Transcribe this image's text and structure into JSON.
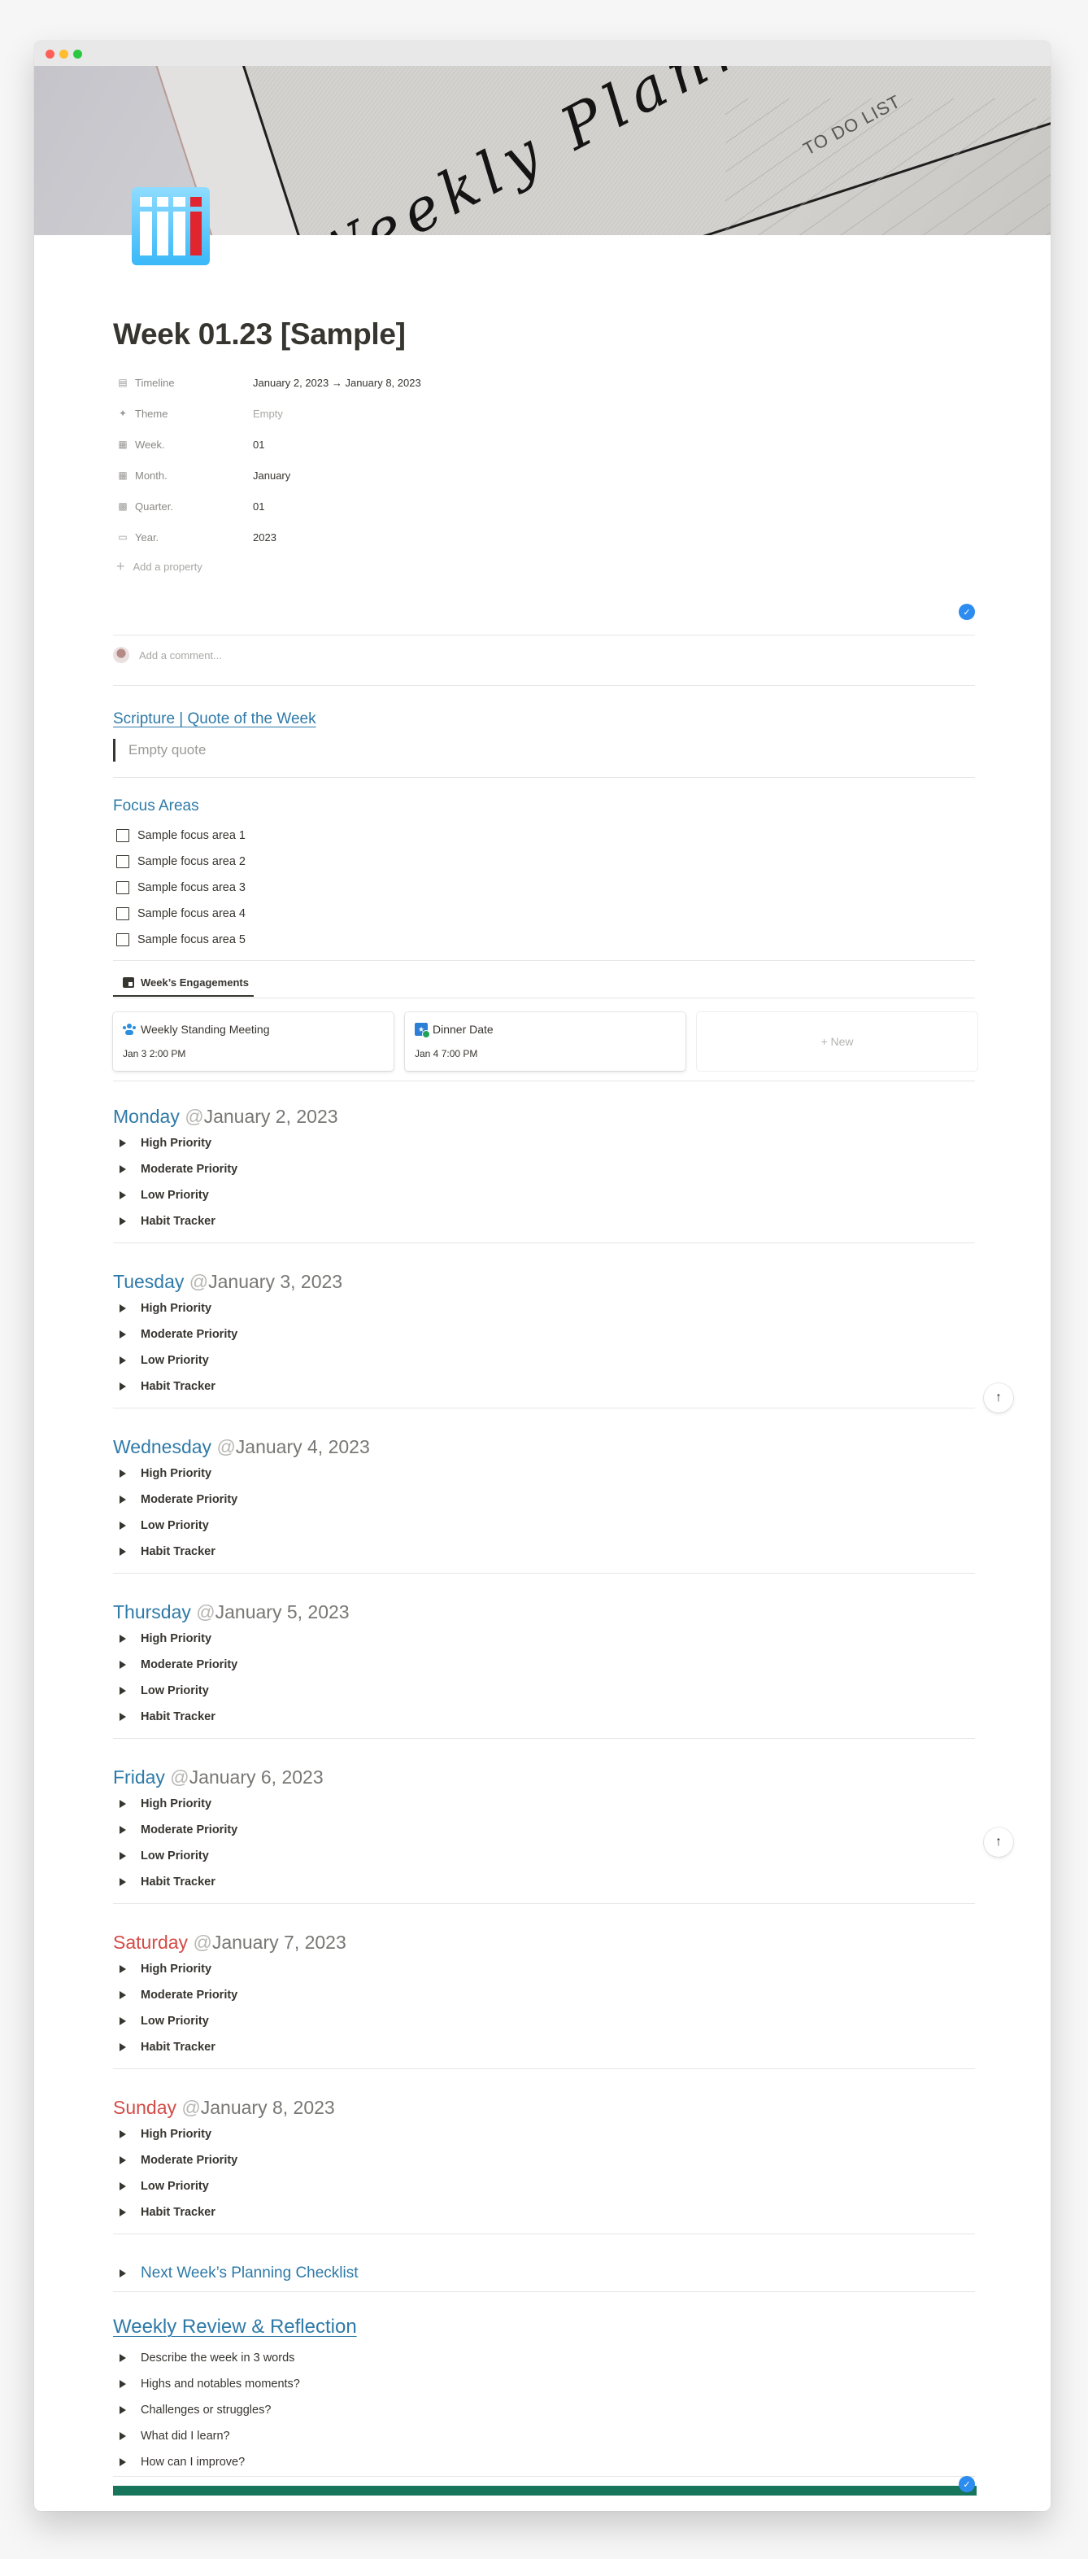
{
  "window": {
    "controls": [
      "close",
      "minimize",
      "maximize"
    ]
  },
  "cover": {
    "script_text": "Weekly Planner",
    "todo_text": "TO DO LIST"
  },
  "page": {
    "icon": "planner-bars-icon",
    "title": "Week 01.23 [Sample]"
  },
  "properties": [
    {
      "icon": "calendar-icon",
      "name": "Timeline",
      "value": "January 2, 2023 → January 8, 2023",
      "empty": false
    },
    {
      "icon": "sparkles-icon",
      "name": "Theme",
      "value": "Empty",
      "empty": true
    },
    {
      "icon": "calendar-week-icon",
      "name": "Week.",
      "value": "01",
      "empty": false
    },
    {
      "icon": "calendar-month-icon",
      "name": "Month.",
      "value": "January",
      "empty": false
    },
    {
      "icon": "grid-icon",
      "name": "Quarter.",
      "value": "01",
      "empty": false
    },
    {
      "icon": "calendar-year-icon",
      "name": "Year.",
      "value": "2023",
      "empty": false
    }
  ],
  "add_property_label": "Add a property",
  "comment": {
    "placeholder": "Add a comment..."
  },
  "quote_section": {
    "heading": "Scripture | Quote of the Week",
    "placeholder": "Empty quote"
  },
  "focus": {
    "heading": "Focus Areas",
    "items": [
      {
        "label": "Sample focus area 1",
        "checked": false
      },
      {
        "label": "Sample focus area 2",
        "checked": false
      },
      {
        "label": "Sample focus area 3",
        "checked": false
      },
      {
        "label": "Sample focus area 4",
        "checked": false
      },
      {
        "label": "Sample focus area 5",
        "checked": false
      }
    ]
  },
  "engagements": {
    "tab_label": "Week’s Engagements",
    "cards": [
      {
        "icon": "meeting-icon",
        "title": "Weekly Standing Meeting",
        "date": "Jan 3 2:00 PM"
      },
      {
        "icon": "calendar-check-icon",
        "title": "Dinner Date",
        "date": "Jan 4 7:00 PM"
      }
    ],
    "new_label": "+ New"
  },
  "days": [
    {
      "name": "Monday",
      "at": "@",
      "date": "January 2, 2023",
      "weekend": false
    },
    {
      "name": "Tuesday",
      "at": "@",
      "date": "January 3, 2023",
      "weekend": false
    },
    {
      "name": "Wednesday",
      "at": "@",
      "date": "January 4, 2023",
      "weekend": false
    },
    {
      "name": "Thursday",
      "at": "@",
      "date": "January 5, 2023",
      "weekend": false
    },
    {
      "name": "Friday",
      "at": "@",
      "date": "January 6, 2023",
      "weekend": false
    },
    {
      "name": "Saturday",
      "at": "@",
      "date": "January 7, 2023",
      "weekend": true
    },
    {
      "name": "Sunday",
      "at": "@",
      "date": "January 8, 2023",
      "weekend": true
    }
  ],
  "day_toggles": [
    "High Priority",
    "Moderate Priority",
    "Low Priority",
    "Habit Tracker"
  ],
  "next_week": {
    "label": "Next Week’s Planning Checklist"
  },
  "review": {
    "heading": "Weekly Review & Reflection",
    "items": [
      "Describe the week in 3 words",
      "Highs and notables moments?",
      "Challenges or struggles?",
      "What did I learn?",
      "How can I improve?"
    ]
  },
  "scroll_top_label": "↑",
  "check_badge_label": "✓",
  "colors": {
    "heading_blue": "#2e7aa8",
    "weekend_red": "#d44c47",
    "footer_green": "#16755a",
    "badge_blue": "#2d8cf0"
  }
}
